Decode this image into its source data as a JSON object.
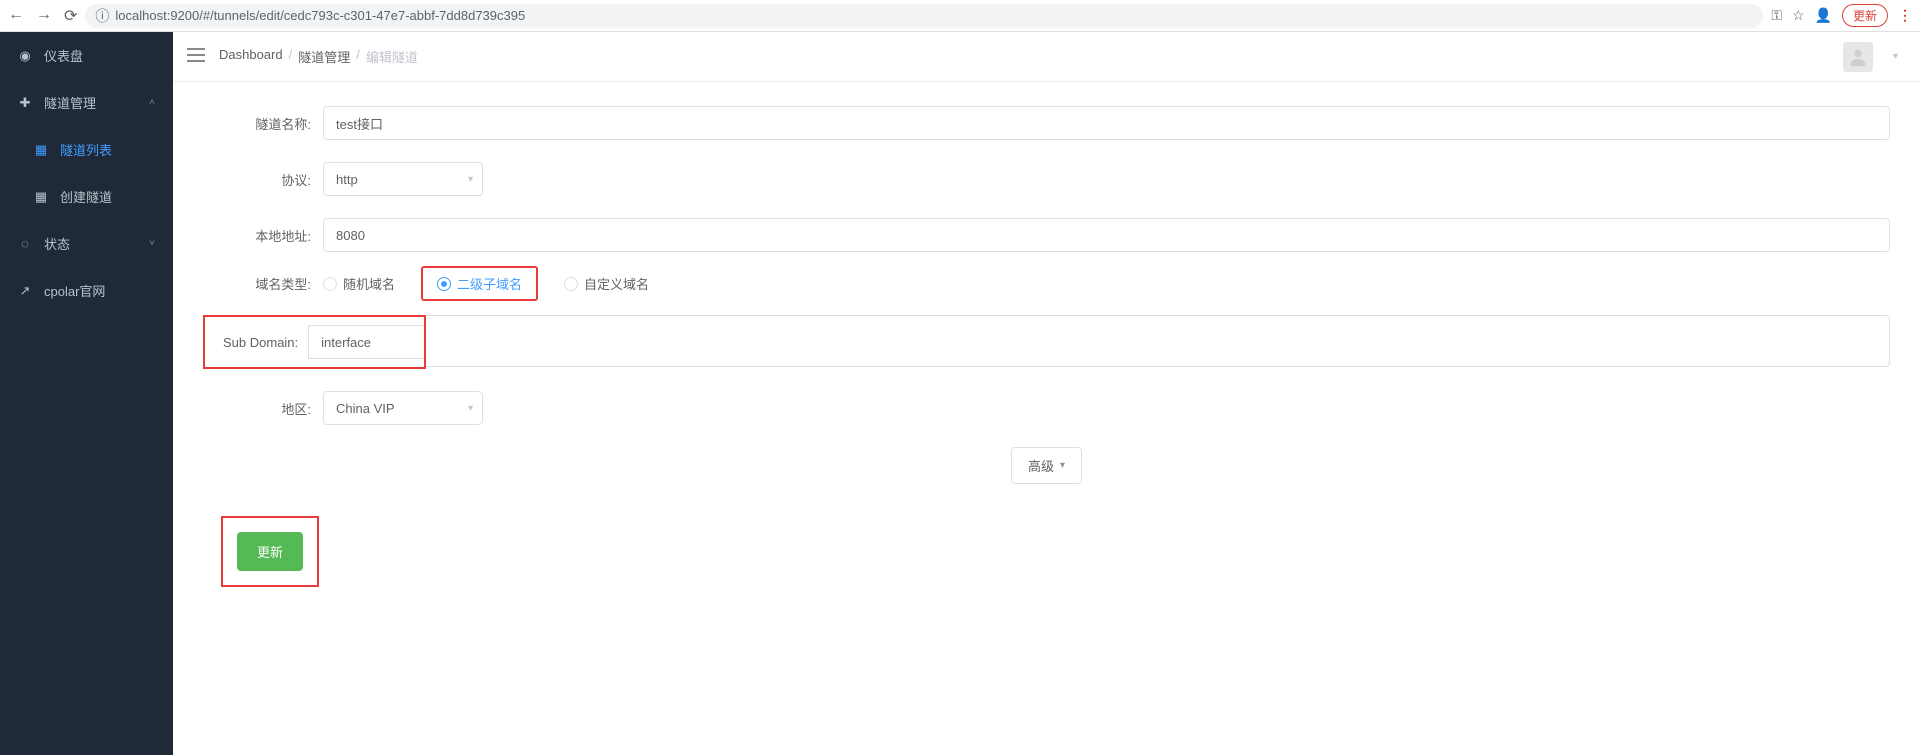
{
  "browser": {
    "url": "localhost:9200/#/tunnels/edit/cedc793c-c301-47e7-abbf-7dd8d739c395",
    "update_label": "更新"
  },
  "sidebar": {
    "items": [
      {
        "label": "仪表盘",
        "icon": "dashboard-icon"
      },
      {
        "label": "隧道管理",
        "icon": "plus-circle-icon",
        "expanded": true
      },
      {
        "label": "隧道列表",
        "icon": "grid-icon",
        "sub": true,
        "active": true
      },
      {
        "label": "创建隧道",
        "icon": "grid-icon",
        "sub": true
      },
      {
        "label": "状态",
        "icon": "refresh-icon",
        "expandable": true
      },
      {
        "label": "cpolar官网",
        "icon": "external-link-icon"
      }
    ]
  },
  "breadcrumb": {
    "items": [
      "Dashboard",
      "隧道管理",
      "编辑隧道"
    ]
  },
  "form": {
    "tunnel_name": {
      "label": "隧道名称:",
      "value": "test接口"
    },
    "protocol": {
      "label": "协议:",
      "value": "http"
    },
    "local_addr": {
      "label": "本地地址:",
      "value": "8080"
    },
    "domain_type": {
      "label": "域名类型:",
      "options": [
        "随机域名",
        "二级子域名",
        "自定义域名"
      ],
      "selected": 1
    },
    "subdomain": {
      "label": "Sub Domain:",
      "value": "interface"
    },
    "region": {
      "label": "地区:",
      "value": "China VIP"
    },
    "advanced_label": "高级",
    "submit_label": "更新"
  }
}
